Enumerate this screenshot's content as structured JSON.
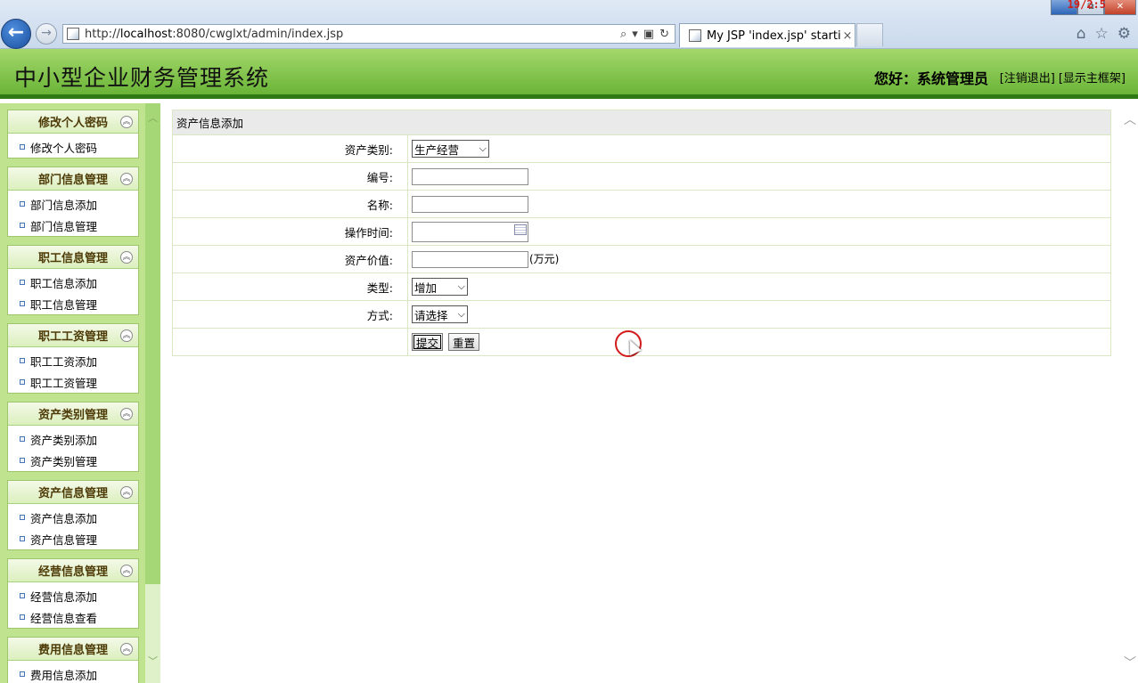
{
  "browser": {
    "clock_overlay": "19/2:5",
    "url_prefix": "http://",
    "url_host": "localhost",
    "url_rest": ":8080/cwglxt/admin/index.jsp",
    "tab_title": "My JSP 'index.jsp' startin...",
    "tab_close": "×",
    "window_buttons": {
      "minimize": "",
      "restore": "⧉",
      "close": "✕"
    }
  },
  "header": {
    "title": "中小型企业财务管理系统",
    "greeting": "您好：系统管理员",
    "logout": "[注销退出]",
    "show_frame": "[显示主框架]"
  },
  "sidebar": {
    "groups": [
      {
        "title": "修改个人密码",
        "items": [
          "修改个人密码"
        ]
      },
      {
        "title": "部门信息管理",
        "items": [
          "部门信息添加",
          "部门信息管理"
        ]
      },
      {
        "title": "职工信息管理",
        "items": [
          "职工信息添加",
          "职工信息管理"
        ]
      },
      {
        "title": "职工工资管理",
        "items": [
          "职工工资添加",
          "职工工资管理"
        ]
      },
      {
        "title": "资产类别管理",
        "items": [
          "资产类别添加",
          "资产类别管理"
        ]
      },
      {
        "title": "资产信息管理",
        "items": [
          "资产信息添加",
          "资产信息管理"
        ]
      },
      {
        "title": "经营信息管理",
        "items": [
          "经营信息添加",
          "经营信息查看"
        ]
      },
      {
        "title": "费用信息管理",
        "items": [
          "费用信息添加"
        ]
      }
    ]
  },
  "form": {
    "caption": "资产信息添加",
    "category_label": "资产类别:",
    "category_value": "生产经营",
    "code_label": "编号:",
    "code_value": "",
    "name_label": "名称:",
    "name_value": "",
    "time_label": "操作时间:",
    "time_value": "",
    "value_label": "资产价值:",
    "value_value": "",
    "value_unit": "(万元)",
    "type_label": "类型:",
    "type_value": "增加",
    "method_label": "方式:",
    "method_value": "请选择",
    "submit_label": "提交",
    "reset_label": "重置"
  }
}
